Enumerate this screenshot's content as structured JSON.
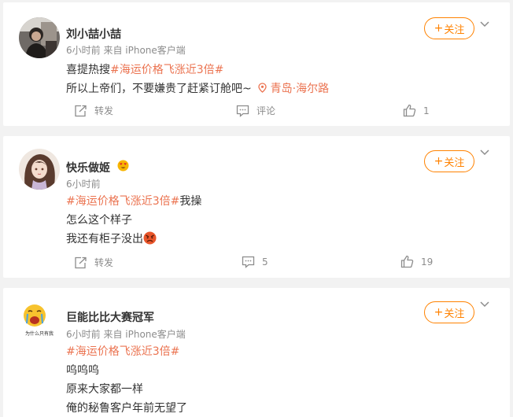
{
  "colors": {
    "accent": "#ff8200",
    "topic": "#eb7350",
    "meta": "#8c8c8c",
    "background": "#f2f2f2"
  },
  "posts": [
    {
      "username": "刘小喆小喆",
      "meta": "6小时前  来自 iPhone客户端",
      "follow_label": "关注",
      "lines": [
        {
          "prefix": "喜提热搜",
          "topic": "#海运价格飞涨近3倍#"
        },
        {
          "text": "所以上帝们，不要嫌贵了赶紧订舱吧~",
          "location": "青岛·海尔路"
        }
      ],
      "actions": {
        "repost": "转发",
        "comment": "评论",
        "like": "1"
      },
      "icons": {
        "avatar": "avatar-photo",
        "location": "location-pin-icon"
      }
    },
    {
      "username": "快乐做姬",
      "meta": "6小时前",
      "follow_label": "关注",
      "lines": [
        {
          "topic": "#海运价格飞涨近3倍#",
          "suffix": "我操"
        },
        {
          "text": "怎么这个样子"
        },
        {
          "text": "我还有柜子没出"
        }
      ],
      "actions": {
        "repost": "转发",
        "comment": "5",
        "like": "19"
      },
      "icons": {
        "avatar": "anime-girl-avatar",
        "badge": "heart-eyes-emoji-icon",
        "inline": "angry-emoji-icon"
      }
    },
    {
      "username": "巨能比比大赛冠军",
      "meta": "6小时前  来自 iPhone客户端",
      "follow_label": "关注",
      "avatar_caption": "为什么只有我",
      "lines": [
        {
          "topic": "#海运价格飞涨近3倍#"
        },
        {
          "text": "呜呜呜"
        },
        {
          "text": "原来大家都一样"
        },
        {
          "text": "俺的秘鲁客户年前无望了"
        }
      ],
      "icons": {
        "avatar": "crying-emoji-avatar"
      }
    }
  ]
}
